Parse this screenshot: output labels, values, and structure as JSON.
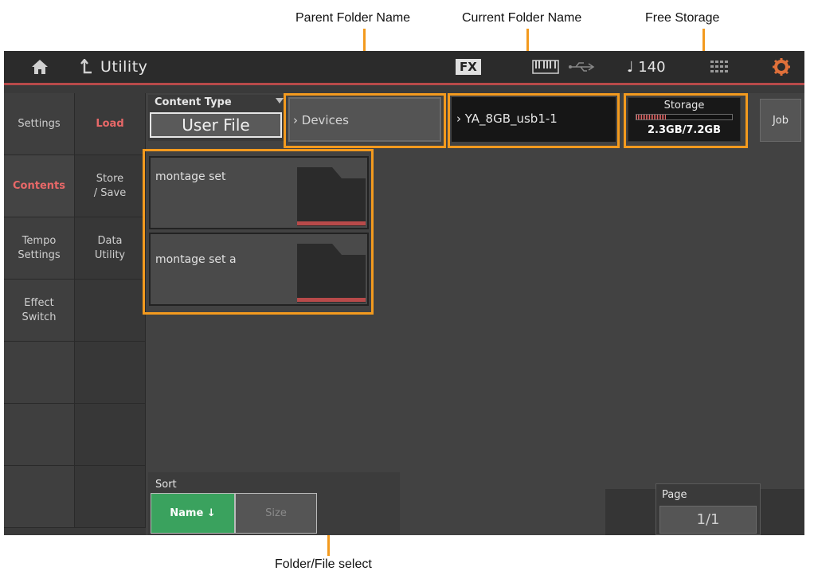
{
  "callouts": {
    "parent_folder": "Parent Folder Name",
    "current_folder": "Current Folder Name",
    "free_storage": "Free Storage",
    "folder_file_select": "Folder/File select"
  },
  "topbar": {
    "title": "Utility",
    "fx_badge": "FX",
    "tempo": "♩ 140"
  },
  "col1": [
    "Settings",
    "Contents",
    "Tempo\nSettings",
    "Effect\nSwitch",
    "",
    "",
    ""
  ],
  "col2": [
    "Load",
    "Store\n/ Save",
    "Data\nUtility",
    "",
    "",
    "",
    ""
  ],
  "content_type": {
    "label": "Content Type",
    "value": "User File"
  },
  "parent_folder": "› Devices",
  "current_folder": "› YA_8GB_usb1-1",
  "storage": {
    "label": "Storage",
    "value": "2.3GB/7.2GB",
    "used_fraction": 0.32
  },
  "job_button": "Job",
  "items": [
    {
      "name": "montage set"
    },
    {
      "name": "montage set a"
    }
  ],
  "sort": {
    "label": "Sort",
    "name_button": "Name ↓",
    "size_button": "Size"
  },
  "page": {
    "label": "Page",
    "value": "1/1"
  },
  "colors": {
    "accent_orange": "#f39a1e",
    "active_red": "#e86868",
    "sort_green": "#3aa25e"
  }
}
